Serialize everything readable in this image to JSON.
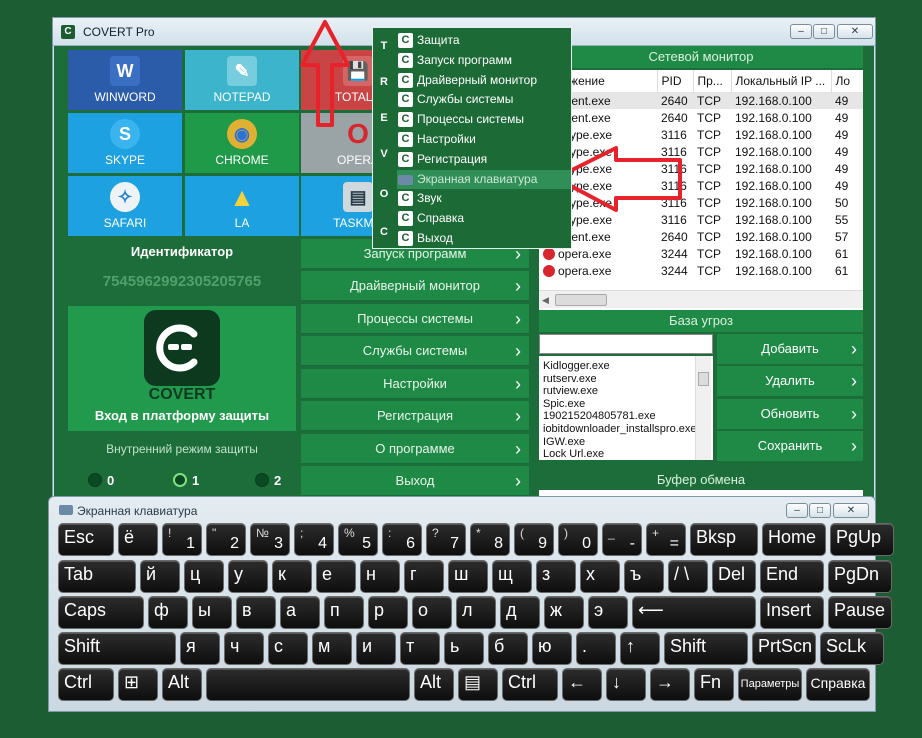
{
  "app": {
    "title": "COVERT Pro",
    "logo_letter": "C"
  },
  "tiles": [
    {
      "label": "WINWORD",
      "bg": "#2a5caa",
      "icon": "W"
    },
    {
      "label": "NOTEPAD",
      "bg": "#3bb4cc",
      "icon": "✎"
    },
    {
      "label": "TOTALC",
      "bg": "#c94444",
      "icon": "💾"
    },
    {
      "label": "SKYPE",
      "bg": "#1ea1e0",
      "icon": "S"
    },
    {
      "label": "CHROME",
      "bg": "#1e9a48",
      "icon": "◉"
    },
    {
      "label": "OPERA",
      "bg": "#9aa3a6",
      "icon": "O"
    },
    {
      "label": "SAFARI",
      "bg": "#1ea1e0",
      "icon": "✧"
    },
    {
      "label": "LA",
      "bg": "#1ea1e0",
      "icon": "▲"
    },
    {
      "label": "TASKMO",
      "bg": "#1ea1e0",
      "icon": "▤"
    }
  ],
  "identifier": {
    "label": "Идентификатор",
    "value": "7545962992305205765"
  },
  "brand": {
    "name": "COVERT",
    "login": "Вход в платформу защиты"
  },
  "internal_mode": {
    "label": "Внутренний режим защиты",
    "options": [
      "0",
      "1",
      "2"
    ]
  },
  "menu_buttons": [
    "Запуск программ",
    "Драйверный монитор",
    "Процессы системы",
    "Службы системы",
    "Настройки",
    "Регистрация",
    "О программе",
    "Выход"
  ],
  "network": {
    "title": "Сетевой монитор",
    "columns": [
      "риложение",
      "PID",
      "Пр...",
      "Локальный IP ...",
      "Ло"
    ],
    "rows": [
      [
        "agent.exe",
        "2640",
        "TCP",
        "192.168.0.100",
        "49"
      ],
      [
        "agent.exe",
        "2640",
        "TCP",
        "192.168.0.100",
        "49"
      ],
      [
        "skype.exe",
        "3116",
        "TCP",
        "192.168.0.100",
        "49"
      ],
      [
        "skype.exe",
        "3116",
        "TCP",
        "192.168.0.100",
        "49"
      ],
      [
        "skype.exe",
        "3116",
        "TCP",
        "192.168.0.100",
        "49"
      ],
      [
        "skype.exe",
        "3116",
        "TCP",
        "192.168.0.100",
        "49"
      ],
      [
        "skype.exe",
        "3116",
        "TCP",
        "192.168.0.100",
        "50"
      ],
      [
        "skype.exe",
        "3116",
        "TCP",
        "192.168.0.100",
        "55"
      ],
      [
        "agent.exe",
        "2640",
        "TCP",
        "192.168.0.100",
        "57"
      ],
      [
        "opera.exe",
        "3244",
        "TCP",
        "192.168.0.100",
        "61"
      ],
      [
        "opera.exe",
        "3244",
        "TCP",
        "192.168.0.100",
        "61"
      ]
    ]
  },
  "threats": {
    "title": "База угроз",
    "items": [
      "Kidlogger.exe",
      "rutserv.exe",
      "rutview.exe",
      "Spic.exe",
      "190215204805781.exe",
      "iobitdownloader_installspro.exe",
      "IGW.exe",
      "Lock Url.exe"
    ],
    "buttons": [
      "Добавить",
      "Удалить",
      "Обновить",
      "Сохранить"
    ]
  },
  "clipboard": {
    "title": "Буфер обмена"
  },
  "popup_menu": {
    "side_text": [
      "T",
      "R",
      "E",
      "V",
      "O",
      "C"
    ],
    "items": [
      "Защита",
      "Запуск программ",
      "Драйверный монитор",
      "Службы системы",
      "Процессы системы",
      "Настройки",
      "Регистрация",
      "Экранная клавиатура",
      "Звук",
      "Справка",
      "Выход"
    ],
    "highlighted": "Экранная клавиатура"
  },
  "keyboard": {
    "title": "Экранная клавиатура",
    "row1": [
      {
        "t": "Esc"
      },
      {
        "t": "ё"
      },
      {
        "s": "!",
        "b": "1"
      },
      {
        "s": "\"",
        "b": "2"
      },
      {
        "s": "№",
        "b": "3"
      },
      {
        "s": ";",
        "b": "4"
      },
      {
        "s": "%",
        "b": "5"
      },
      {
        "s": ":",
        "b": "6"
      },
      {
        "s": "?",
        "b": "7"
      },
      {
        "s": "*",
        "b": "8"
      },
      {
        "s": "(",
        "b": "9"
      },
      {
        "s": ")",
        "b": "0"
      },
      {
        "s": "_",
        "b": "-"
      },
      {
        "s": "+",
        "b": "="
      },
      {
        "t": "Bksp"
      },
      {
        "t": "Home"
      },
      {
        "t": "PgUp"
      }
    ],
    "row2": [
      "Tab",
      "й",
      "ц",
      "у",
      "к",
      "е",
      "н",
      "г",
      "ш",
      "щ",
      "з",
      "х",
      "ъ",
      "/ \\",
      "Del",
      "End",
      "PgDn"
    ],
    "row3": [
      "Caps",
      "ф",
      "ы",
      "в",
      "а",
      "п",
      "р",
      "о",
      "л",
      "д",
      "ж",
      "э",
      "⟵",
      "Insert",
      "Pause"
    ],
    "row4": [
      "Shift",
      "я",
      "ч",
      "с",
      "м",
      "и",
      "т",
      "ь",
      "б",
      "ю",
      ".",
      "↑",
      "Shift",
      "PrtScn",
      "ScLk"
    ],
    "row5": [
      "Ctrl",
      "⊞",
      "Alt",
      "",
      "Alt",
      "▤",
      "Ctrl",
      "←",
      "↓",
      "→",
      "Fn",
      "Параметры",
      "Справка"
    ]
  }
}
